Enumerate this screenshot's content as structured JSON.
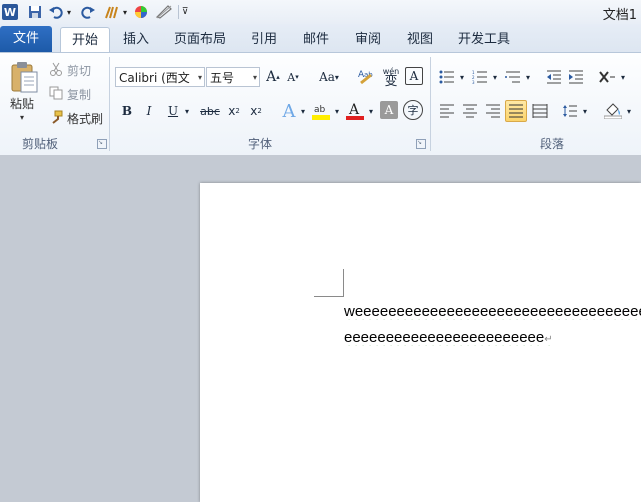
{
  "window": {
    "title": "文档1"
  },
  "tabs": [
    {
      "label": "文件"
    },
    {
      "label": "开始"
    },
    {
      "label": "插入"
    },
    {
      "label": "页面布局"
    },
    {
      "label": "引用"
    },
    {
      "label": "邮件"
    },
    {
      "label": "审阅"
    },
    {
      "label": "视图"
    },
    {
      "label": "开发工具"
    }
  ],
  "clipboard": {
    "paste": "粘贴",
    "cut": "剪切",
    "copy": "复制",
    "format_painter": "格式刷",
    "group_label": "剪贴板"
  },
  "font": {
    "font_name": "Calibri (西文",
    "font_size": "五号",
    "case_label": "Aa",
    "group_label": "字体",
    "pinyin_label": "wén",
    "pinyin_char": "变"
  },
  "paragraph": {
    "group_label": "段落"
  },
  "document": {
    "lines": [
      "weeeeeeeeeeeeeeeeeeeeeeeeeeeeeeeeeeeeeeeeee",
      "eeeeeeeeeeeeeeeeeeeeeeee"
    ],
    "pilcrow": "↵"
  }
}
